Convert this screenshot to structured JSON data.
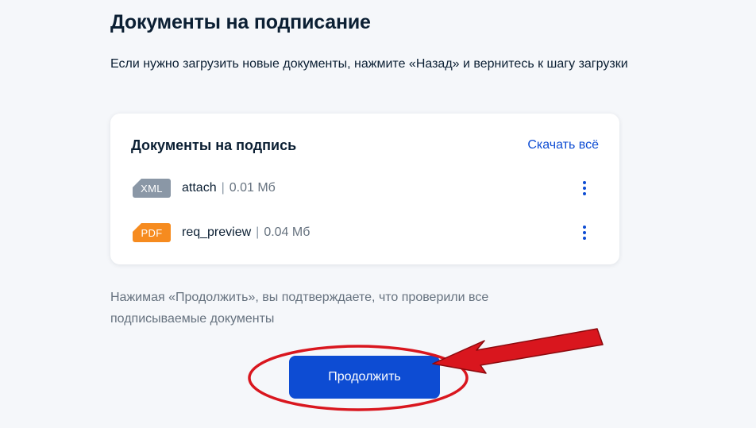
{
  "page": {
    "title": "Документы на подписание",
    "intro": "Если нужно загрузить новые документы, нажмите «Назад» и вернитесь к шагу загрузки"
  },
  "card": {
    "title": "Документы на подпись",
    "download_all": "Скачать всё",
    "files": [
      {
        "type": "XML",
        "name": "attach",
        "separator": "|",
        "size": "0.01 Мб",
        "color": "#8a97a6",
        "menu_icon": "kebab-icon"
      },
      {
        "type": "PDF",
        "name": "req_preview",
        "separator": "|",
        "size": "0.04 Мб",
        "color": "#f68b1f",
        "menu_icon": "kebab-icon"
      }
    ]
  },
  "confirm_note": "Нажимая «Продолжить», вы подтверждаете, что проверили все подписываемые документы",
  "continue_button": {
    "label": "Продолжить",
    "color": "#0d4cd3"
  },
  "annotation": {
    "color": "#d9161e",
    "icons": [
      "highlight-ellipse",
      "pointer-arrow"
    ]
  },
  "colors": {
    "link": "#0d4cd3",
    "text": "#0b1f33",
    "muted": "#66727f",
    "background": "#f5f7fa"
  }
}
